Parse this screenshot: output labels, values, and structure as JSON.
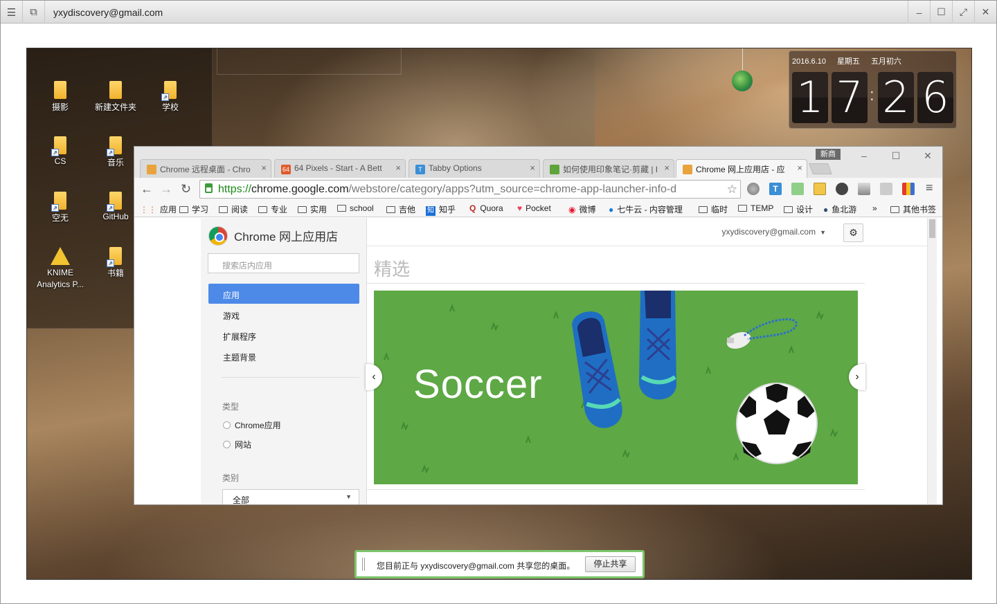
{
  "outer_window": {
    "title": "yxydiscovery@gmail.com"
  },
  "desktop": {
    "icons": [
      {
        "label": "摄影"
      },
      {
        "label": "新建文件夹"
      },
      {
        "label": "学校"
      },
      {
        "label": "CS"
      },
      {
        "label": "音乐"
      },
      {
        "label": "空无"
      },
      {
        "label": "GitHub"
      },
      {
        "label": "KNIME Analytics P..."
      },
      {
        "label": "书籍"
      }
    ],
    "clock": {
      "date": "2016.6.10",
      "weekday": "星期五",
      "lunar": "五月初六",
      "h1": "1",
      "h2": "7",
      "m1": "2",
      "m2": "6"
    }
  },
  "chrome": {
    "user_badge": "新商",
    "tabs": [
      {
        "title": "Chrome 远程桌面 - Chro",
        "icon_color": "#e8a33d"
      },
      {
        "title": "64 Pixels - Start - A Bett",
        "icon_text": "64",
        "icon_color": "#e05a2b"
      },
      {
        "title": "Tabby Options",
        "icon_text": "T",
        "icon_color": "#3b8fd6"
      },
      {
        "title": "如何使用印象笔记·剪藏 | I",
        "icon_color": "#5da53a"
      },
      {
        "title": "Chrome 网上应用店 - 应",
        "icon_color": "#e8a33d"
      }
    ],
    "url": {
      "scheme": "https://",
      "host": "chrome.google.com",
      "path": "/webstore/category/apps?utm_source=chrome-app-launcher-info-d"
    },
    "bookmarks": [
      "应用",
      "学习",
      "阅读",
      "专业",
      "实用",
      "school",
      "吉他",
      "知乎",
      "Quora",
      "Pocket",
      "微博",
      "七牛云 - 内容管理",
      "临时",
      "TEMP",
      "设计",
      "鱼北游",
      "»",
      "其他书签"
    ],
    "store": {
      "title": "Chrome 网上应用店",
      "search_placeholder": "搜索店内应用",
      "categories": [
        "应用",
        "游戏",
        "扩展程序",
        "主题背景"
      ],
      "type_label": "类型",
      "types": [
        "Chrome应用",
        "网站"
      ],
      "kind_label": "类别",
      "kind_value": "全部",
      "account": "yxydiscovery@gmail.com",
      "featured": "精选",
      "banner_text": "Soccer"
    }
  },
  "share_bar": {
    "text": "您目前正与 yxydiscovery@gmail.com 共享您的桌面。",
    "stop": "停止共享"
  }
}
